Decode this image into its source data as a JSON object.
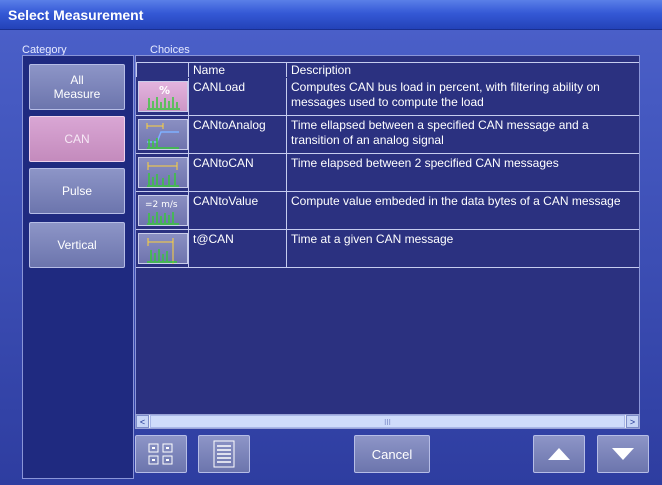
{
  "window": {
    "title": "Select Measurement"
  },
  "labels": {
    "category": "Category",
    "choices": "Choices"
  },
  "categories": [
    {
      "label": "All\nMeasure",
      "selected": false
    },
    {
      "label": "CAN",
      "selected": true
    },
    {
      "label": "Pulse",
      "selected": false
    },
    {
      "label": "Vertical",
      "selected": false
    }
  ],
  "columns": {
    "name": "Name",
    "description": "Description"
  },
  "choices": [
    {
      "name": "CANLoad",
      "description": "Computes CAN bus load in percent, with filtering ability on messages used to compute the load",
      "icon": "percent-icon",
      "icon_text": "%",
      "selected": true
    },
    {
      "name": "CANtoAnalog",
      "description": "Time ellapsed between a specified CAN message and a transition of an analog signal",
      "icon": "can-to-analog-icon",
      "icon_text": "",
      "selected": false
    },
    {
      "name": "CANtoCAN",
      "description": "Time elapsed between 2 specified CAN messages",
      "icon": "can-to-can-icon",
      "icon_text": "",
      "selected": false
    },
    {
      "name": "CANtoValue",
      "description": "Compute value embeded in the data bytes of a CAN message",
      "icon": "can-to-value-icon",
      "icon_text": "=2 m/s",
      "selected": false
    },
    {
      "name": "t@CAN",
      "description": "Time at a given CAN message",
      "icon": "time-at-can-icon",
      "icon_text": "",
      "selected": false
    }
  ],
  "scrollbar": {
    "left": "<",
    "right": ">",
    "grip": "III"
  },
  "buttons": {
    "cancel": "Cancel"
  },
  "colors": {
    "title_bar": "#3559d6",
    "selected_category": "#d9a6d4",
    "panel": "#2b3180",
    "icon_green": "#38c93a"
  }
}
